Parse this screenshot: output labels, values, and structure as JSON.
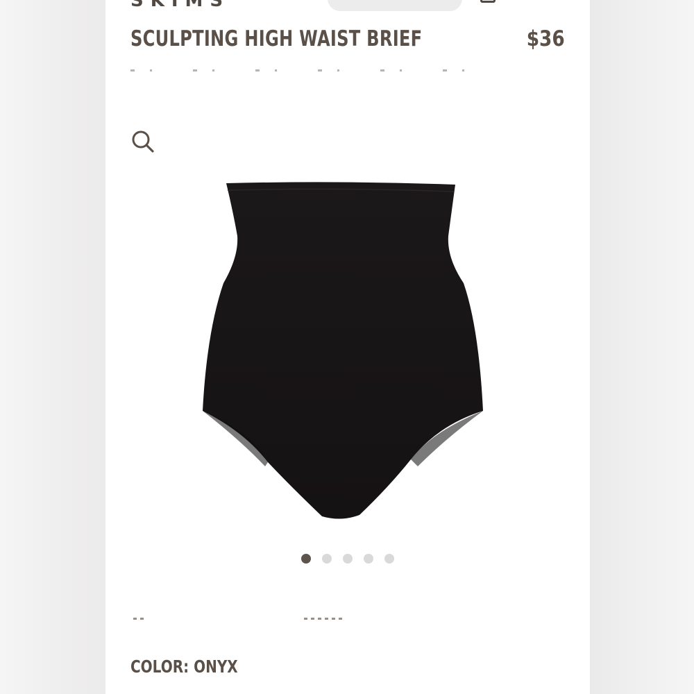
{
  "header": {
    "brand_cropped": "SKIMS",
    "search_pill": "",
    "bag_icon": "bag-icon"
  },
  "product": {
    "title": "SCULPTING HIGH WAIST BRIEF",
    "price": "$36",
    "image_icon": "zoom-icon",
    "garment_color": "#1a1718"
  },
  "carousel": {
    "total": 5,
    "active_index": 0
  },
  "color": {
    "label": "COLOR:",
    "value": "ONYX"
  },
  "colors": {
    "text": "#5a5048",
    "dot_active": "#5c534c",
    "dot_inactive": "#d9d9d9"
  }
}
